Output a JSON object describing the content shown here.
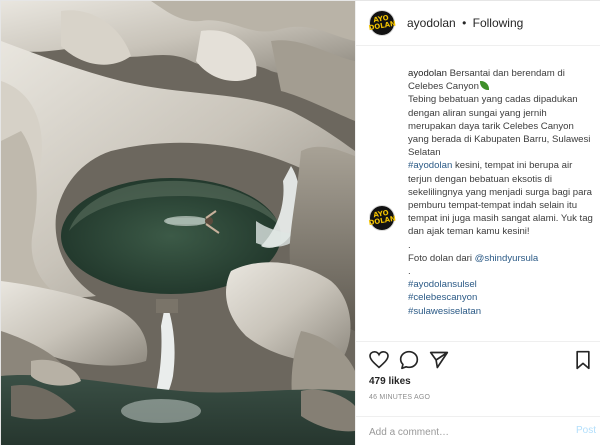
{
  "header": {
    "username": "ayodolan",
    "separator": "•",
    "follow_status": "Following",
    "avatar_mark": "AYO DOLAN"
  },
  "caption": {
    "username": "ayodolan",
    "title": "Bersantai dan berendam di Celebes Canyon",
    "title_emoji": "leaf-emoji",
    "body_1": "Tebing bebatuan yang cadas dipadukan dengan aliran sungai yang jernih merupakan daya tarik Celebes Canyon yang berada di Kabupaten Barru, Sulawesi Selatan",
    "mention_1": "#ayodolan",
    "body_2": "kesini, tempat ini berupa air terjun dengan bebatuan eksotis di sekelilingnya yang menjadi surga bagi para pemburu tempat-tempat indah selain itu tempat ini juga masih sangat alami. Yuk tag dan ajak teman kamu kesini!",
    "dot": ".",
    "credit_prefix": "Foto dolan dari",
    "credit_user": "@shindyursula",
    "hashtags": [
      "#ayodolansulsel",
      "#celebescanyon",
      "#sulawesiselatan"
    ]
  },
  "actions": {
    "like_icon": "heart-icon",
    "comment_icon": "comment-icon",
    "share_icon": "share-icon",
    "save_icon": "bookmark-icon"
  },
  "likes": "479 likes",
  "time": "46 MINUTES AGO",
  "comment": {
    "placeholder": "Add a comment…",
    "post_label": "Post"
  },
  "colors": {
    "link": "#2b5a86",
    "post_button": "#b2dffc",
    "avatar_bg": "#121212",
    "avatar_text": "#f2c200",
    "water": "#2f4a3a"
  }
}
